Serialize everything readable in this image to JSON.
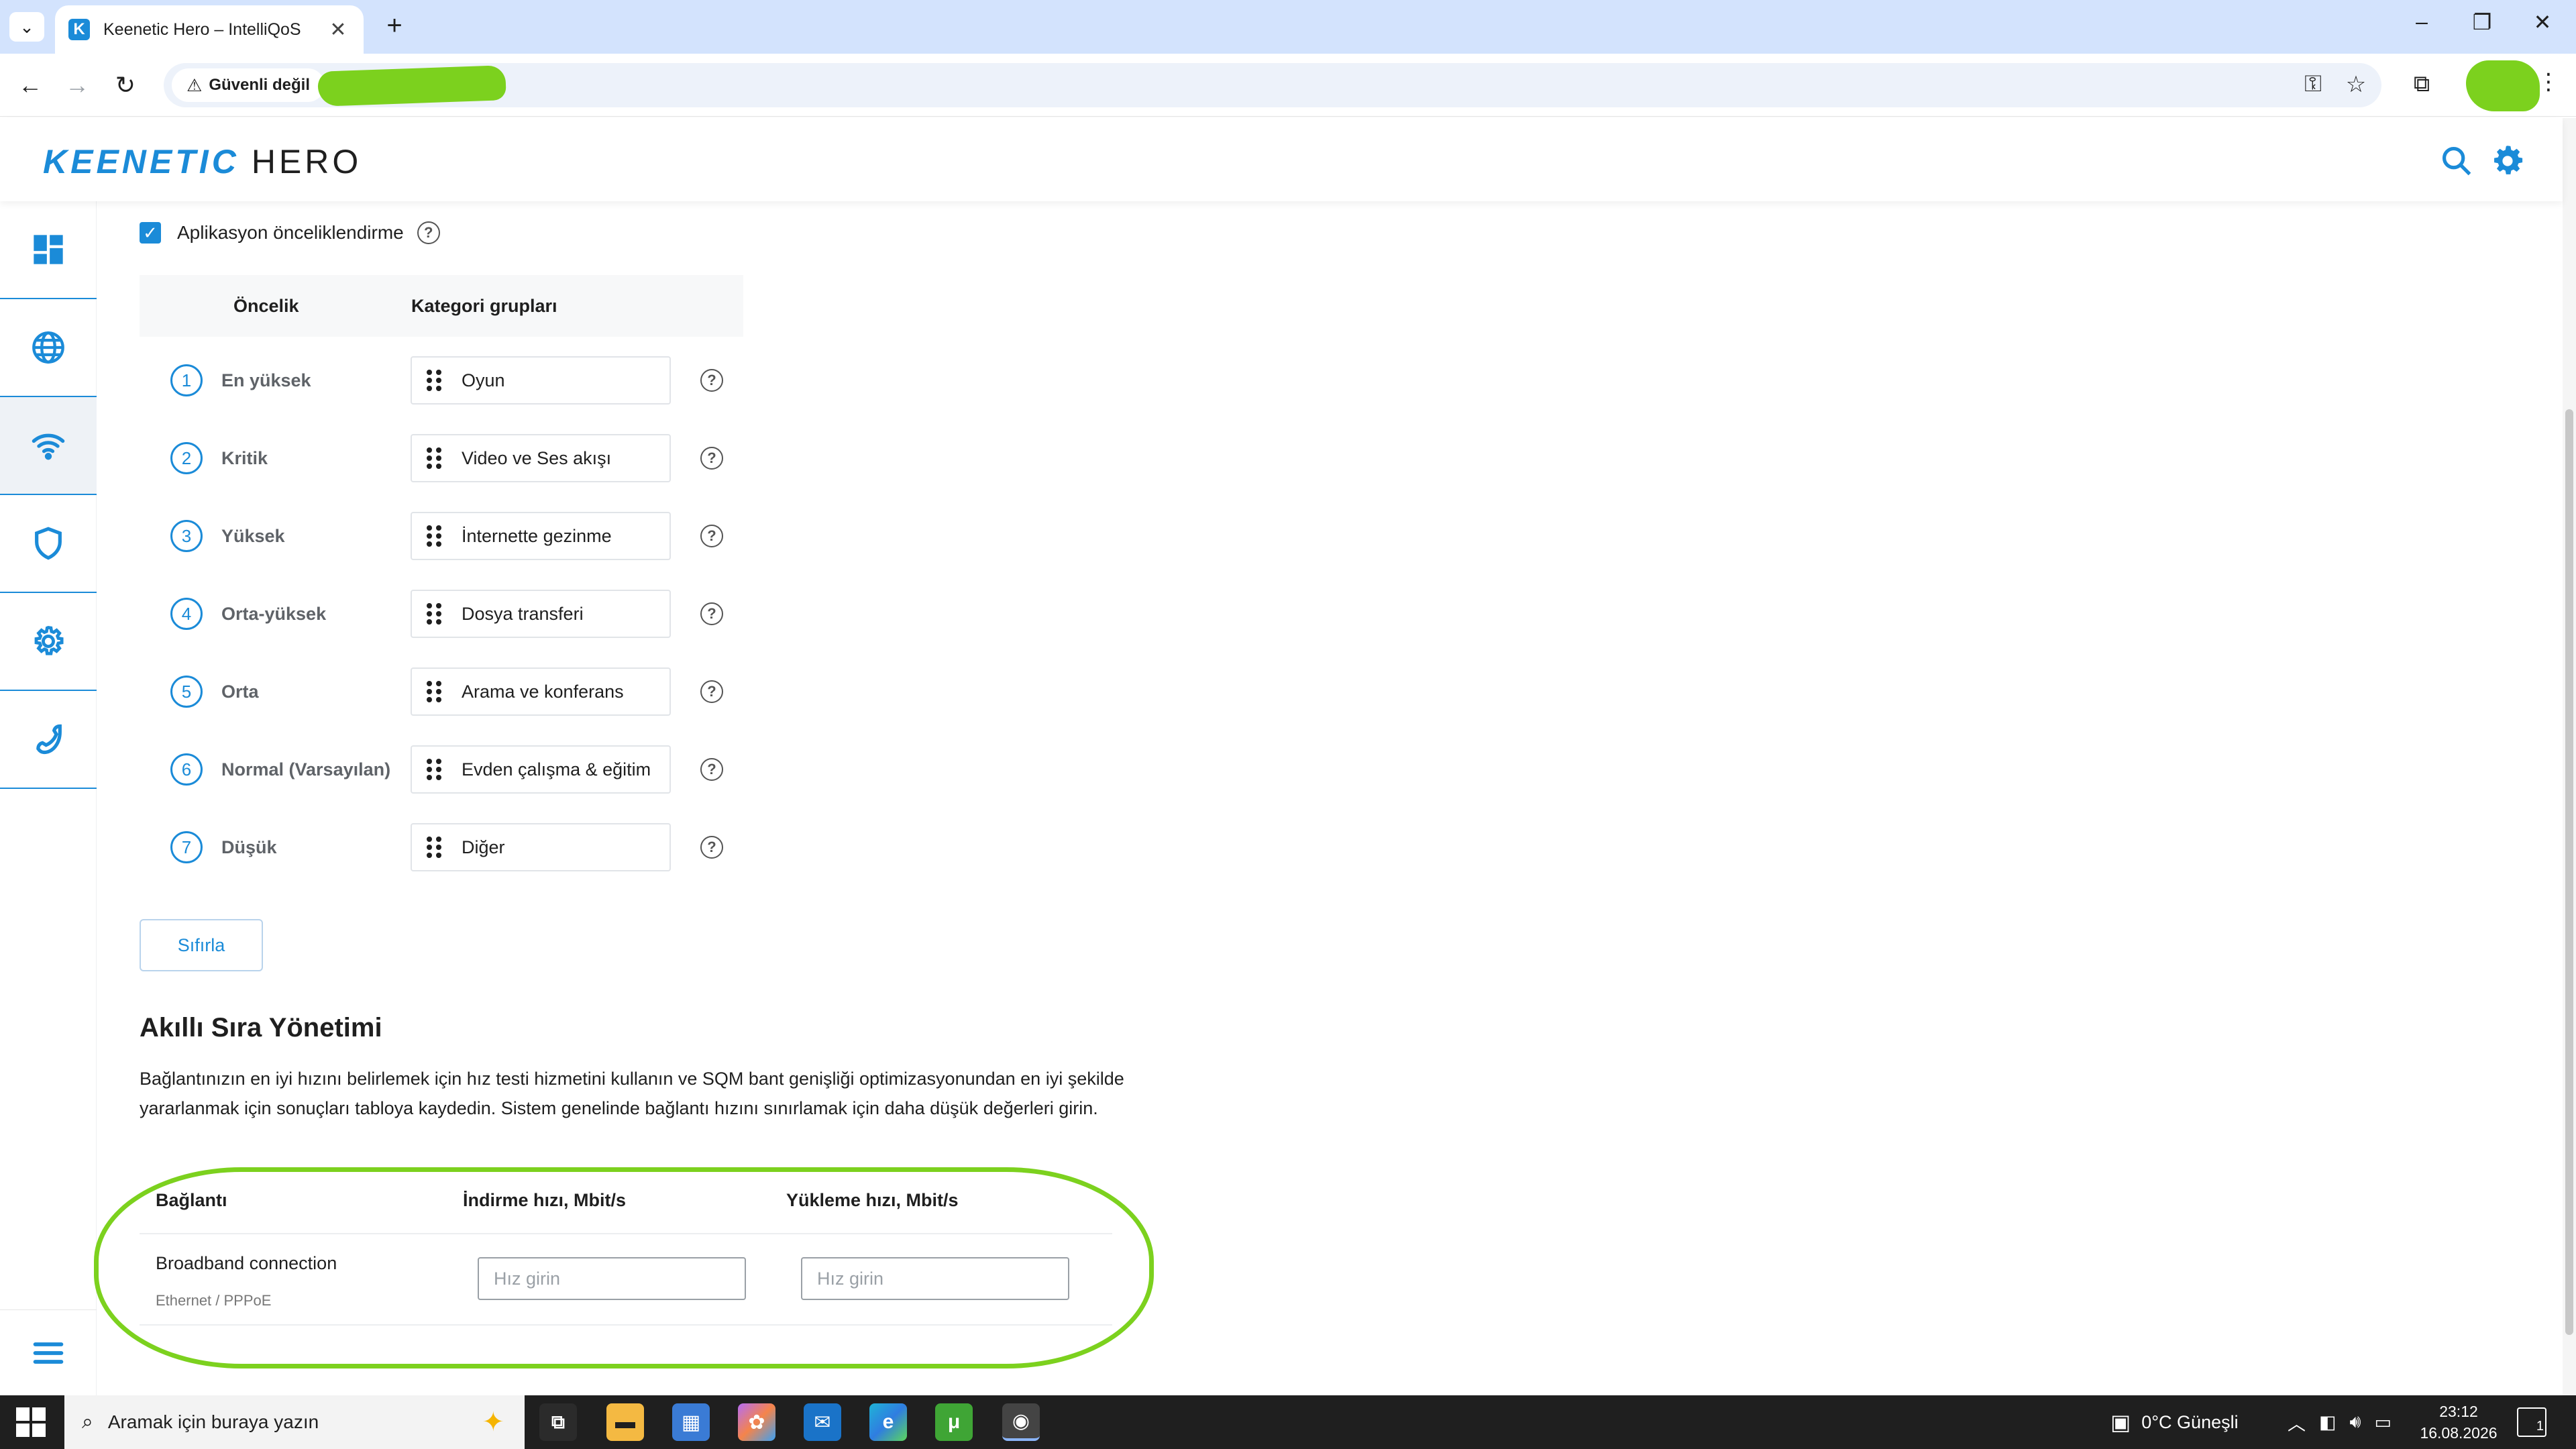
{
  "browser": {
    "tab_title": "Keenetic Hero – IntelliQoS",
    "favicon_letter": "K",
    "security_label": "Güvenli değil",
    "tab_dropdown_icon": "chevron-down-icon",
    "tab_close_glyph": "✕",
    "new_tab_glyph": "+",
    "window_controls": [
      "–",
      "❐",
      "✕"
    ]
  },
  "app": {
    "logo_primary": "KEENETIC",
    "logo_secondary": "HERO",
    "accent_color": "#1b8bd8"
  },
  "sidebar": {
    "items": [
      {
        "icon": "dashboard-icon"
      },
      {
        "icon": "globe-icon"
      },
      {
        "icon": "wifi-icon",
        "active": true
      },
      {
        "icon": "shield-icon"
      },
      {
        "icon": "gear-icon"
      },
      {
        "icon": "phone-icon"
      }
    ],
    "menu_icon": "hamburger-menu-icon"
  },
  "app_priority": {
    "checkbox_label": "Aplikasyon önceliklendirme",
    "checked": true,
    "col_priority": "Öncelik",
    "col_categories": "Kategori grupları",
    "rows": [
      {
        "num": "1",
        "level": "En yüksek",
        "category": "Oyun"
      },
      {
        "num": "2",
        "level": "Kritik",
        "category": "Video ve Ses akışı"
      },
      {
        "num": "3",
        "level": "Yüksek",
        "category": "İnternette gezinme"
      },
      {
        "num": "4",
        "level": "Orta-yüksek",
        "category": "Dosya transferi"
      },
      {
        "num": "5",
        "level": "Orta",
        "category": "Arama ve konferans"
      },
      {
        "num": "6",
        "level": "Normal (Varsayılan)",
        "category": "Evden çalışma & eğitim"
      },
      {
        "num": "7",
        "level": "Düşük",
        "category": "Diğer"
      }
    ],
    "reset_label": "Sıfırla"
  },
  "sqm": {
    "title": "Akıllı Sıra Yönetimi",
    "description": "Bağlantınızın en iyi hızını belirlemek için hız testi hizmetini kullanın ve SQM bant genişliği optimizasyonundan en iyi şekilde yararlanmak için sonuçları tabloya kaydedin. Sistem genelinde bağlantı hızını sınırlamak için daha düşük değerleri girin.",
    "col_connection": "Bağlantı",
    "col_download": "İndirme hızı, Mbit/s",
    "col_upload": "Yükleme hızı, Mbit/s",
    "connection_name": "Broadband connection",
    "connection_type": "Ethernet / PPPoE",
    "download_value": "",
    "upload_value": "",
    "placeholder": "Hız girin"
  },
  "taskbar": {
    "search_placeholder": "Aramak için buraya yazın",
    "weather": "0°C  Güneşli",
    "time": "23:12",
    "date": "16.08.2026",
    "notification_count": "1"
  }
}
